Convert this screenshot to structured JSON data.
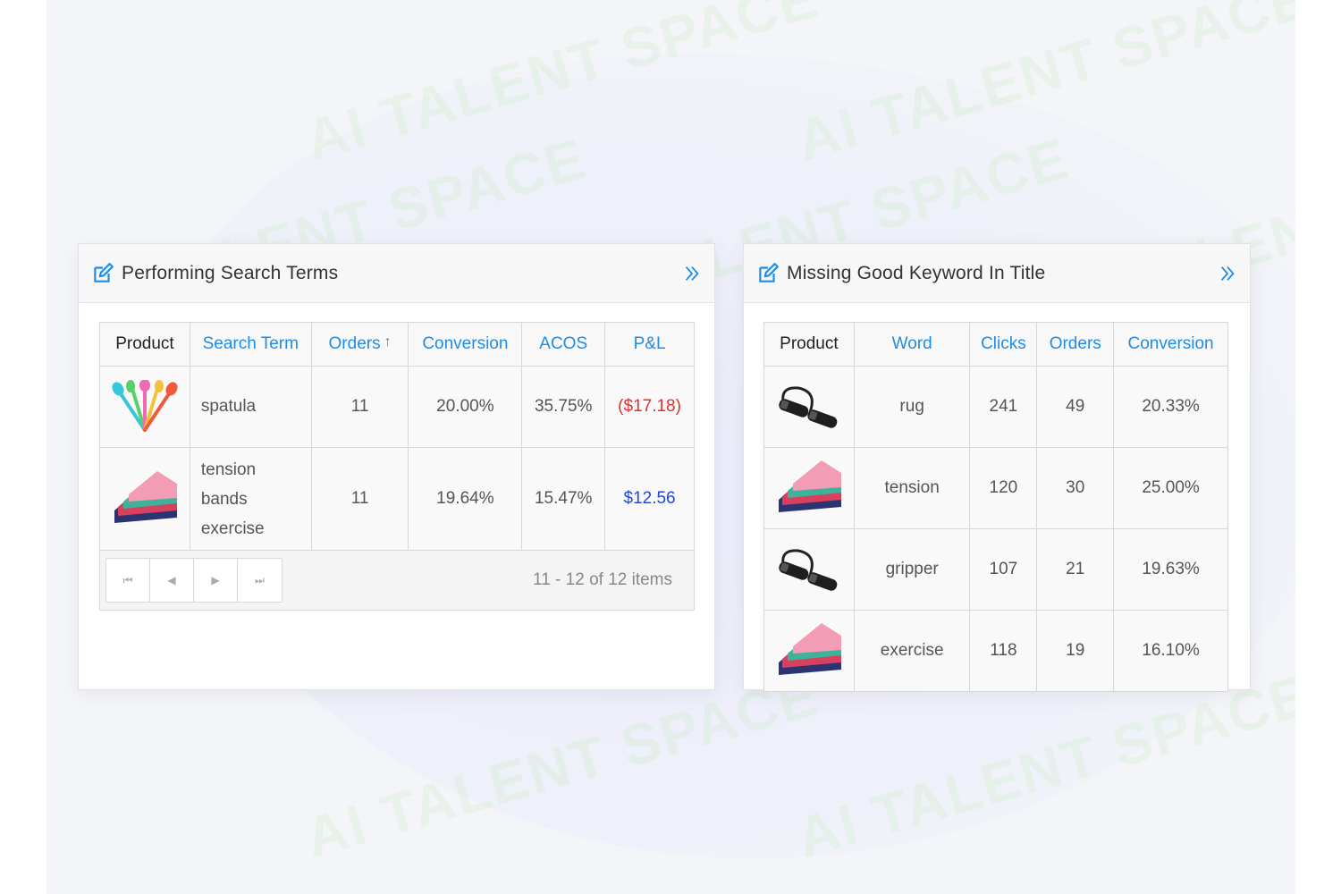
{
  "watermark": "AI TALENT SPACE",
  "left_panel": {
    "title": "Performing Search Terms",
    "columns": [
      "Product",
      "Search Term",
      "Orders",
      "Conversion",
      "ACOS",
      "P&L"
    ],
    "sort_indicator": "↑",
    "rows": [
      {
        "product_icon": "spatula-product-icon",
        "term": "spatula",
        "orders": "11",
        "conversion": "20.00%",
        "acos": "35.75%",
        "pl": "($17.18)"
      },
      {
        "product_icon": "tension-bands-product-icon",
        "term_lines": [
          "tension",
          "bands",
          "exercise"
        ],
        "orders": "11",
        "conversion": "19.64%",
        "acos": "15.47%",
        "pl": "$12.56"
      }
    ],
    "pager": {
      "first": "⏮",
      "prev": "◀",
      "next": "▶",
      "last": "⏭",
      "info": "11 - 12 of 12 items"
    }
  },
  "right_panel": {
    "title": "Missing Good Keyword In Title",
    "columns": [
      "Product",
      "Word",
      "Clicks",
      "Orders",
      "Conversion"
    ],
    "rows": [
      {
        "product_icon": "jump-rope-product-icon",
        "word": "rug",
        "clicks": "241",
        "orders": "49",
        "conversion": "20.33%"
      },
      {
        "product_icon": "tension-bands-product-icon",
        "word": "tension",
        "clicks": "120",
        "orders": "30",
        "conversion": "25.00%"
      },
      {
        "product_icon": "jump-rope-product-icon",
        "word": "gripper",
        "clicks": "107",
        "orders": "21",
        "conversion": "19.63%"
      },
      {
        "product_icon": "tension-bands-product-icon",
        "word": "exercise",
        "clicks": "118",
        "orders": "19",
        "conversion": "16.10%"
      }
    ]
  },
  "colors": {
    "link": "#1f8ce6",
    "negative": "#e0302b",
    "positive": "#2346d8"
  }
}
